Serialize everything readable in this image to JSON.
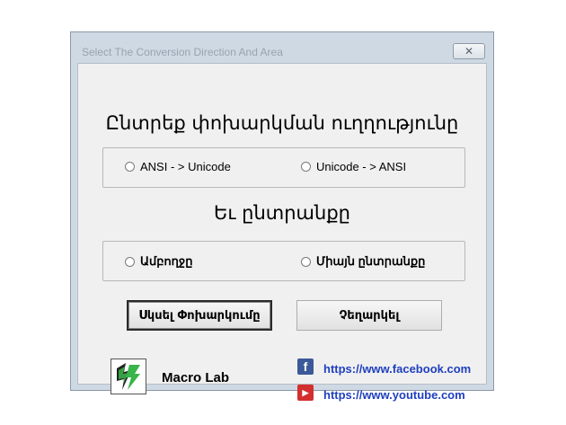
{
  "window": {
    "title": "Select The Conversion Direction And Area",
    "close_glyph": "✕"
  },
  "direction": {
    "heading": "Ընտրեք փոխարկման ուղղությունը",
    "options": [
      "ANSI - > Unicode",
      "Unicode - > ANSI"
    ]
  },
  "area": {
    "heading": "Եւ ընտրանքը",
    "options": [
      "Ամբողջը",
      "Միայն ընտրանքը"
    ]
  },
  "buttons": {
    "start": "Սկսել Փոխարկումը",
    "cancel": "Չեղարկել"
  },
  "brand": {
    "name": "Macro Lab",
    "icon": "macro-lab-logo"
  },
  "links": {
    "facebook": "https://www.facebook.com",
    "youtube": "https://www.youtube.com"
  },
  "colors": {
    "facebook": "#3b5998",
    "youtube": "#d32f2f",
    "link": "#1f3fbf",
    "logo_green": "#39b54a"
  }
}
